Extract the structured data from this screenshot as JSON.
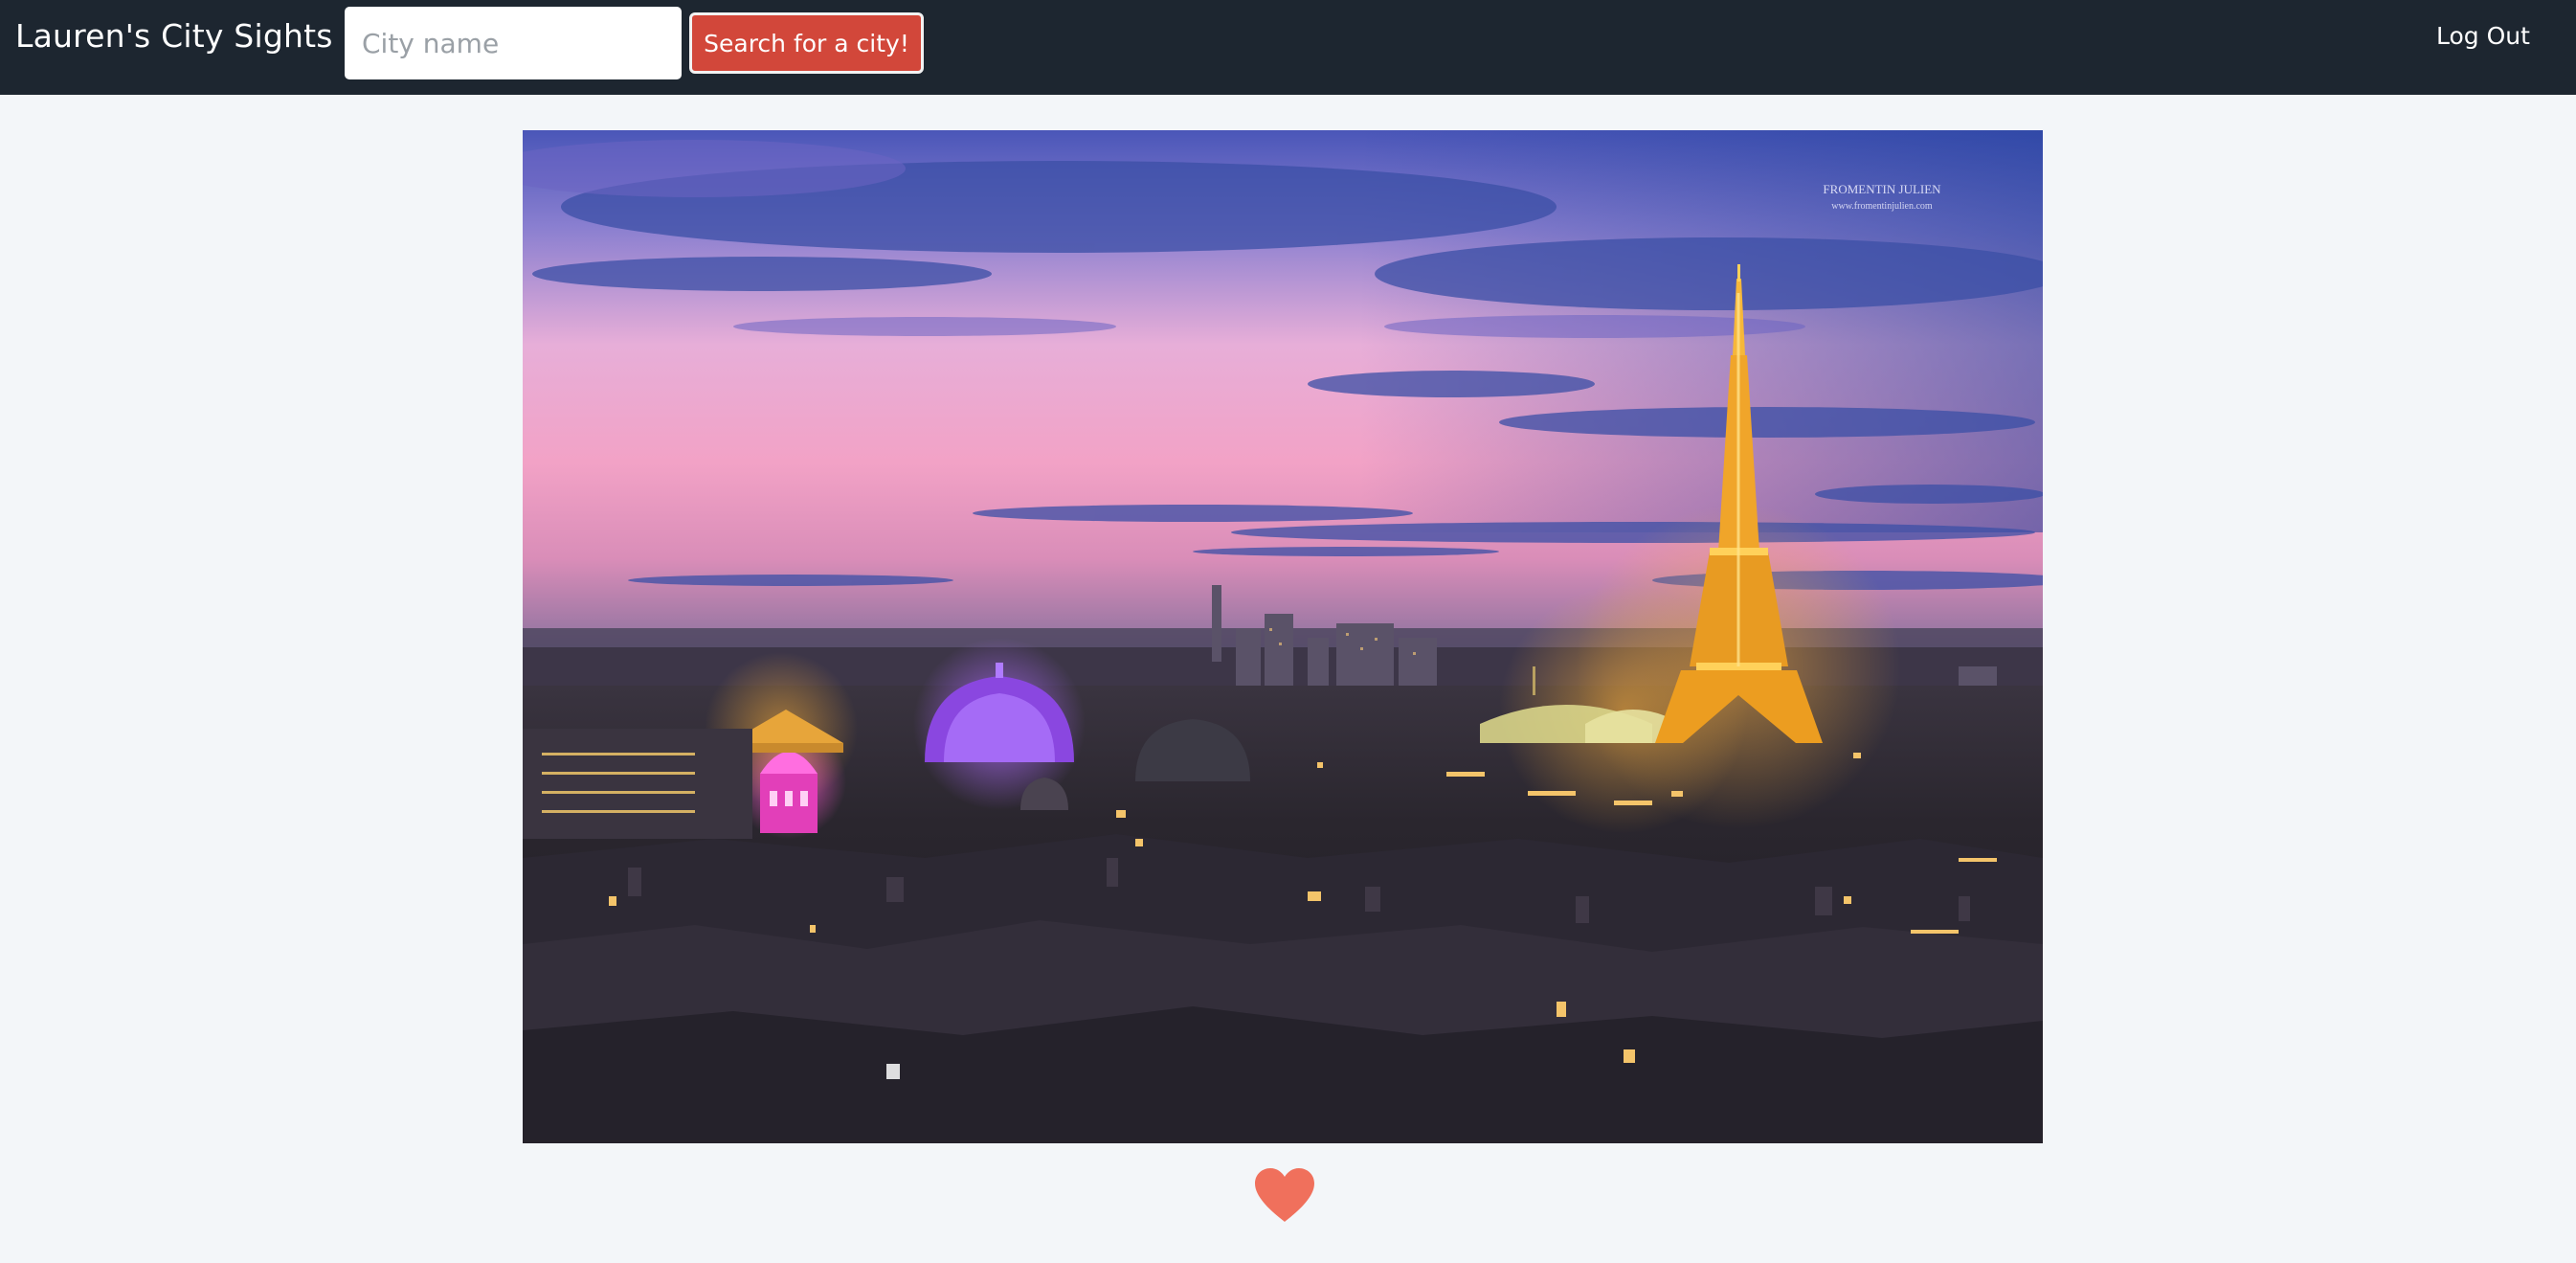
{
  "navbar": {
    "brand": "Lauren's City Sights",
    "search_placeholder": "City name",
    "search_value": "",
    "search_button_label": "Search for a city!",
    "logout_label": "Log Out"
  },
  "photo": {
    "subject": "Paris skyline at dusk with the Eiffel Tower",
    "watermark_line1": "FROMENTIN JULIEN",
    "watermark_line2": "www.fromentinjulien.com"
  },
  "favorite": {
    "icon": "heart-icon",
    "color": "#f0705c"
  },
  "colors": {
    "navbar_bg": "#1d2630",
    "page_bg": "#f3f6f9",
    "button_bg": "#d2473a"
  }
}
